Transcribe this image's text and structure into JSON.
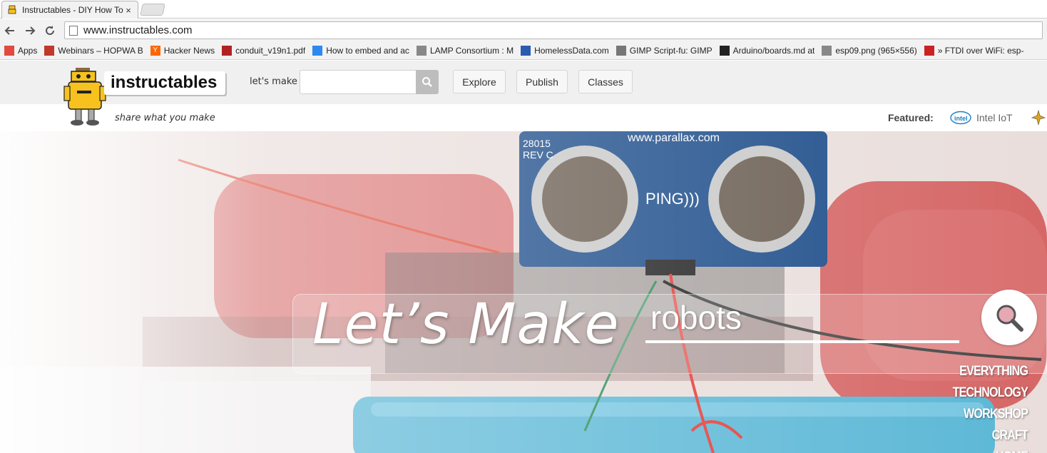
{
  "browser": {
    "tab": {
      "title": "Instructables - DIY How To",
      "close": "×"
    },
    "url": "www.instructables.com",
    "bookmarks": [
      {
        "label": "Apps",
        "icon": "apps-grid-icon",
        "color": "#e04a3f"
      },
      {
        "label": "Webinars – HOPWA B",
        "icon": "house-icon",
        "color": "#c0392b"
      },
      {
        "label": "Hacker News",
        "icon": "hacker-news-icon",
        "color": "#ff6600",
        "glyph": "Y"
      },
      {
        "label": "conduit_v19n1.pdf",
        "icon": "shield-icon",
        "color": "#b22222"
      },
      {
        "label": "How to embed and ac",
        "icon": "windows-icon",
        "color": "#2d89ef"
      },
      {
        "label": "LAMP Consortium : M",
        "icon": "page-icon",
        "color": "#888888"
      },
      {
        "label": "HomelessData.com",
        "icon": "globe-icon",
        "color": "#2a5db0"
      },
      {
        "label": "GIMP Script-fu: GIMP",
        "icon": "home-outline-icon",
        "color": "#777777"
      },
      {
        "label": "Arduino/boards.md at",
        "icon": "github-icon",
        "color": "#222222"
      },
      {
        "label": "esp09.png (965×556)",
        "icon": "page-icon",
        "color": "#888888"
      },
      {
        "label": "» FTDI over WiFi: esp-",
        "icon": "circle-logo-icon",
        "color": "#cc2222"
      }
    ]
  },
  "site": {
    "logo_text": "instructables",
    "tagline": "share what you make",
    "lets_make_small": "let's make",
    "search_placeholder": "",
    "nav": [
      {
        "label": "Explore"
      },
      {
        "label": "Publish"
      },
      {
        "label": "Classes"
      }
    ],
    "featured_label": "Featured:",
    "featured_items": [
      {
        "label": "Intel IoT"
      }
    ],
    "brand_color": "#f7c21e"
  },
  "hero": {
    "headline": "Let’s Make",
    "search_value": "robots",
    "categories": [
      {
        "label": "EVERYTHING"
      },
      {
        "label": "TECHNOLOGY"
      },
      {
        "label": "WORKSHOP"
      },
      {
        "label": "CRAFT"
      },
      {
        "label": "HOME"
      }
    ]
  }
}
